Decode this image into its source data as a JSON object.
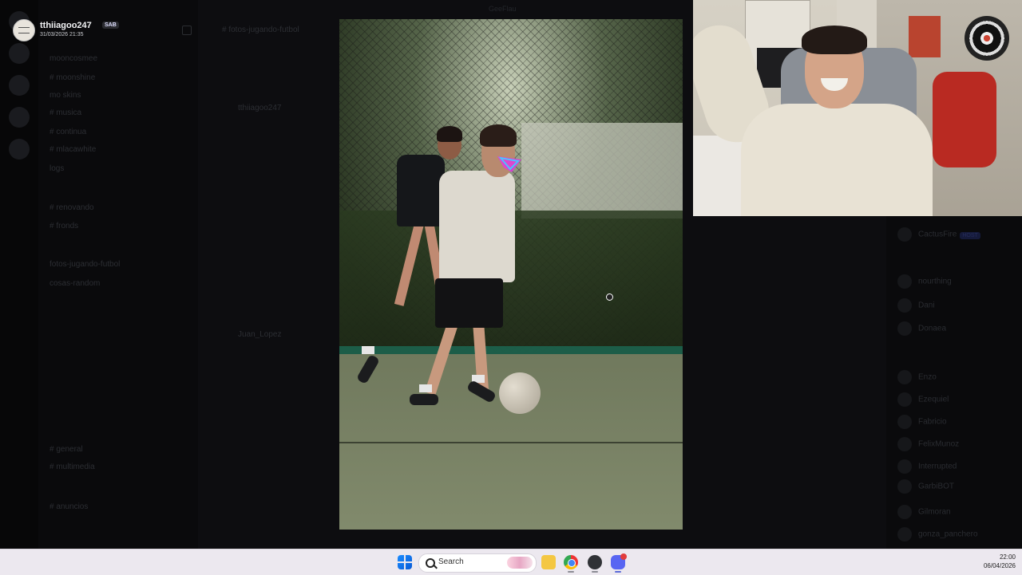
{
  "window": {
    "title": "GeeFlau"
  },
  "user_card": {
    "username": "tthiiagoo247",
    "tag": "SAB",
    "datetime": "31/03/2026 21:35"
  },
  "channels": {
    "items": [
      "mooncosmee",
      "# moonshine",
      "mo skins",
      "# musica",
      "# continua",
      "# mlacawhite",
      "logs",
      "# renovando",
      "# fronds",
      "fotos-jugando-futbol",
      "cosas-random",
      "# general",
      "# multimedia",
      "# anuncios"
    ]
  },
  "chat": {
    "author": "tthiiagoo247",
    "author2": "Juan_Lopez",
    "channel": "# fotos-jugando-futbol"
  },
  "members": [
    "CactusFire",
    "nourthing",
    "Dani",
    "Donaea",
    "Enzo",
    "Ezequiel",
    "Fabricio",
    "FelixMunoz",
    "Interrupted",
    "GarbiBOT",
    "Gilmoran",
    "gonza_panchero"
  ],
  "taskbar": {
    "search_placeholder": "Search",
    "time": "22:00",
    "date": "06/04/2026"
  },
  "colors": {
    "discord_blurple": "#5865f2",
    "taskbar_bg": "#ece8ef"
  }
}
